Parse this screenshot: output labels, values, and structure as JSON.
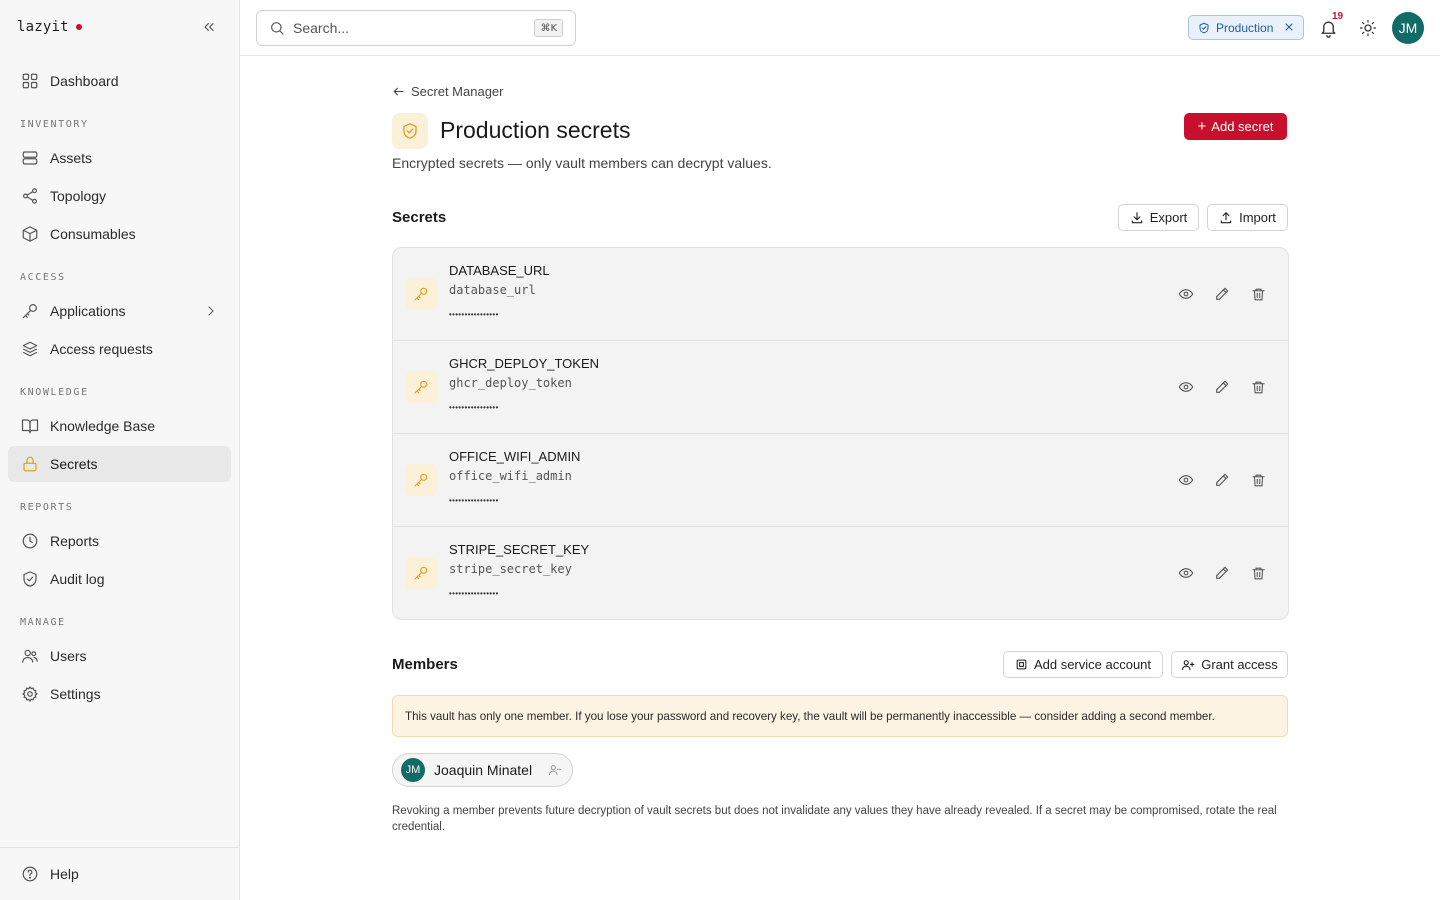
{
  "brand": {
    "name": "lazyit"
  },
  "sidebar": {
    "items": {
      "dashboard": "Dashboard",
      "assets": "Assets",
      "topology": "Topology",
      "consumables": "Consumables",
      "applications": "Applications",
      "access_requests": "Access requests",
      "knowledge_base": "Knowledge Base",
      "secrets": "Secrets",
      "reports": "Reports",
      "audit_log": "Audit log",
      "users": "Users",
      "settings": "Settings"
    },
    "sections": {
      "inventory": "INVENTORY",
      "access": "ACCESS",
      "knowledge": "KNOWLEDGE",
      "reports": "REPORTS",
      "manage": "MANAGE"
    },
    "active": "secrets",
    "footer": {
      "help": "Help"
    }
  },
  "topbar": {
    "search_placeholder": "Search...",
    "search_shortcut": "⌘K",
    "environment": "Production",
    "notification_count": "19",
    "user_initials": "JM"
  },
  "page": {
    "breadcrumb": "Secret Manager",
    "title": "Production secrets",
    "description": "Encrypted secrets — only vault members can decrypt values.",
    "add_secret_label": "Add secret"
  },
  "secrets_section": {
    "title": "Secrets",
    "export_label": "Export",
    "import_label": "Import",
    "items": [
      {
        "name": "DATABASE_URL",
        "key": "database_url",
        "masked": "••••••••••••••••"
      },
      {
        "name": "GHCR_DEPLOY_TOKEN",
        "key": "ghcr_deploy_token",
        "masked": "••••••••••••••••"
      },
      {
        "name": "OFFICE_WIFI_ADMIN",
        "key": "office_wifi_admin",
        "masked": "••••••••••••••••"
      },
      {
        "name": "STRIPE_SECRET_KEY",
        "key": "stripe_secret_key",
        "masked": "••••••••••••••••"
      }
    ]
  },
  "members_section": {
    "title": "Members",
    "add_service_account_label": "Add service account",
    "grant_access_label": "Grant access",
    "warning": "This vault has only one member. If you lose your password and recovery key, the vault will be permanently inaccessible — consider adding a second member.",
    "members": [
      {
        "initials": "JM",
        "name": "Joaquin Minatel"
      }
    ],
    "footnote": "Revoking a member prevents future decryption of vault secrets but does not invalidate any values they have already revealed. If a secret may be compromised, rotate the real credential."
  },
  "colors": {
    "accent": "#c8102e",
    "avatar": "#136b68",
    "secret_icon": "#e0a020",
    "environment_chip": "#1f5fa8"
  }
}
